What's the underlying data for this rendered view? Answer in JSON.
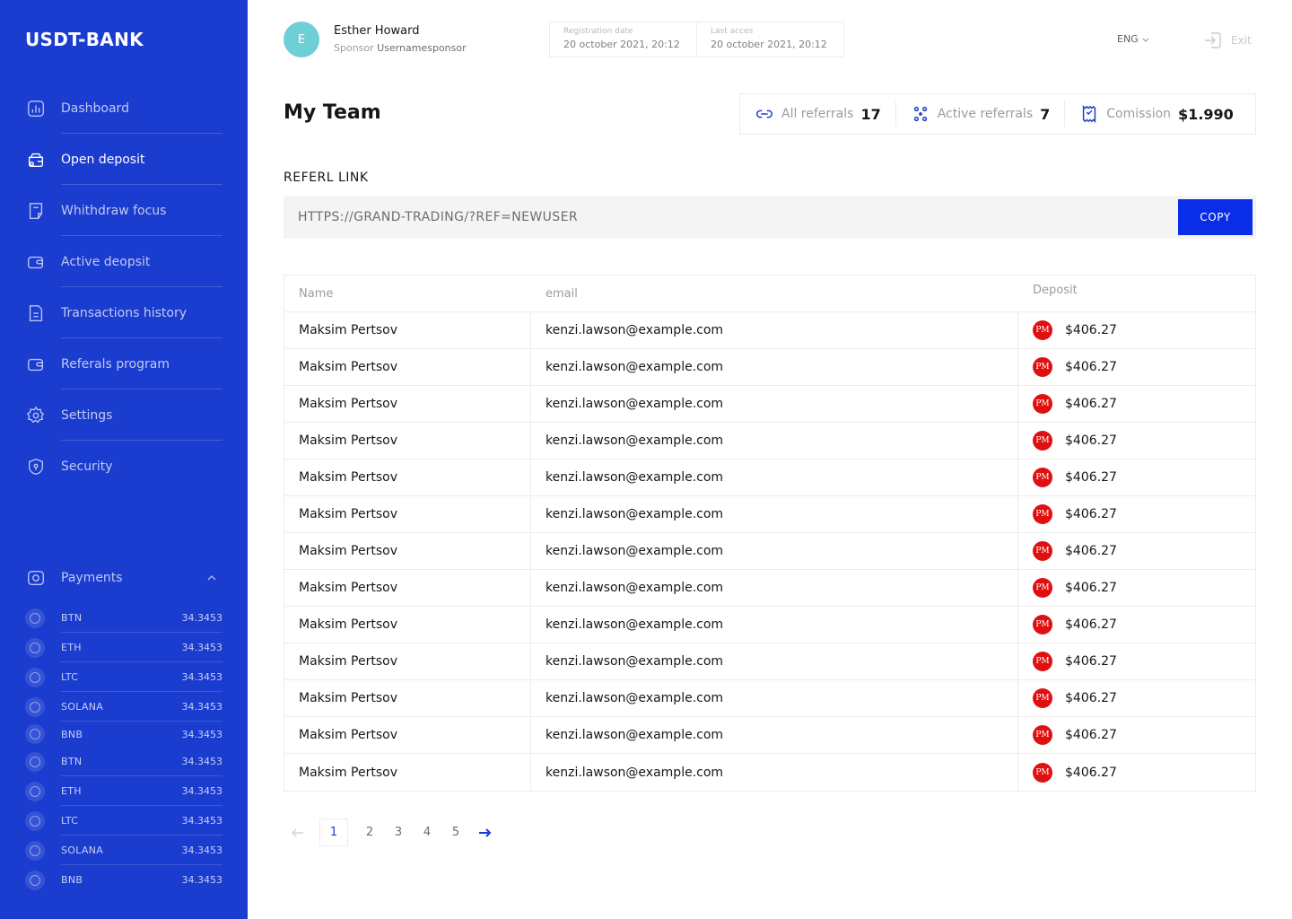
{
  "app": {
    "logo": "USDT-BANK"
  },
  "colors": {
    "sidebar": "#1a3ccf",
    "accent": "#0a2ee8",
    "pm_badge": "#e01010",
    "avatar": "#6ecfd6"
  },
  "sidebar": {
    "items": [
      {
        "label": "Dashboard",
        "icon": "chart-icon"
      },
      {
        "label": "Open deposit",
        "icon": "wallet-icon"
      },
      {
        "label": "Whithdraw focus",
        "icon": "document-icon"
      },
      {
        "label": "Active deopsit",
        "icon": "wallet-card-icon"
      },
      {
        "label": "Transactions history",
        "icon": "file-icon"
      },
      {
        "label": "Referals program",
        "icon": "wallet-card-icon"
      },
      {
        "label": "Settings",
        "icon": "gear-icon"
      },
      {
        "label": "Security",
        "icon": "shield-icon"
      }
    ],
    "active_index": 1,
    "payments": {
      "label": "Payments",
      "rows": [
        {
          "name": "BTN",
          "value": "34.3453"
        },
        {
          "name": "ETH",
          "value": "34.3453"
        },
        {
          "name": "LTC",
          "value": "34.3453"
        },
        {
          "name": "SOLANA",
          "value": "34.3453"
        },
        {
          "name": "BNB",
          "value": "34.3453"
        },
        {
          "name": "BTN",
          "value": "34.3453"
        },
        {
          "name": "ETH",
          "value": "34.3453"
        },
        {
          "name": "LTC",
          "value": "34.3453"
        },
        {
          "name": "SOLANA",
          "value": "34.3453"
        },
        {
          "name": "BNB",
          "value": "34.3453"
        }
      ]
    }
  },
  "header": {
    "avatar_initial": "E",
    "user_name": "Esther Howard",
    "sponsor_label": "Sponsor",
    "sponsor_value": "Usernamesponsor",
    "registration_label": "Registration date",
    "registration_value": "20 october 2021, 20:12",
    "last_access_label": "Last acces",
    "last_access_value": "20 october 2021, 20:12",
    "language": "ENG",
    "exit_label": "Exit"
  },
  "main": {
    "title": "My Team",
    "stats": [
      {
        "label": "All referrals",
        "value": "17",
        "icon": "link-icon"
      },
      {
        "label": "Active referrals",
        "value": "7",
        "icon": "dots-icon"
      },
      {
        "label": "Comission",
        "value": "$1.990",
        "icon": "receipt-icon"
      }
    ],
    "ref_label": "REFERL LINK",
    "ref_url": "HTTPS://GRAND-TRADING/?REF=NEWUSER",
    "copy_label": "COPY"
  },
  "table": {
    "headers": {
      "name": "Name",
      "email": "email",
      "deposit": "Deposit"
    },
    "badge": "PM",
    "rows": [
      {
        "name": "Maksim Pertsov",
        "email": "kenzi.lawson@example.com",
        "deposit": "$406.27"
      },
      {
        "name": "Maksim Pertsov",
        "email": "kenzi.lawson@example.com",
        "deposit": "$406.27"
      },
      {
        "name": "Maksim Pertsov",
        "email": "kenzi.lawson@example.com",
        "deposit": "$406.27"
      },
      {
        "name": "Maksim Pertsov",
        "email": "kenzi.lawson@example.com",
        "deposit": "$406.27"
      },
      {
        "name": "Maksim Pertsov",
        "email": "kenzi.lawson@example.com",
        "deposit": "$406.27"
      },
      {
        "name": "Maksim Pertsov",
        "email": "kenzi.lawson@example.com",
        "deposit": "$406.27"
      },
      {
        "name": "Maksim Pertsov",
        "email": "kenzi.lawson@example.com",
        "deposit": "$406.27"
      },
      {
        "name": "Maksim Pertsov",
        "email": "kenzi.lawson@example.com",
        "deposit": "$406.27"
      },
      {
        "name": "Maksim Pertsov",
        "email": "kenzi.lawson@example.com",
        "deposit": "$406.27"
      },
      {
        "name": "Maksim Pertsov",
        "email": "kenzi.lawson@example.com",
        "deposit": "$406.27"
      },
      {
        "name": "Maksim Pertsov",
        "email": "kenzi.lawson@example.com",
        "deposit": "$406.27"
      },
      {
        "name": "Maksim Pertsov",
        "email": "kenzi.lawson@example.com",
        "deposit": "$406.27"
      },
      {
        "name": "Maksim Pertsov",
        "email": "kenzi.lawson@example.com",
        "deposit": "$406.27"
      }
    ]
  },
  "pagination": {
    "pages": [
      "1",
      "2",
      "3",
      "4",
      "5"
    ],
    "current": "1"
  }
}
